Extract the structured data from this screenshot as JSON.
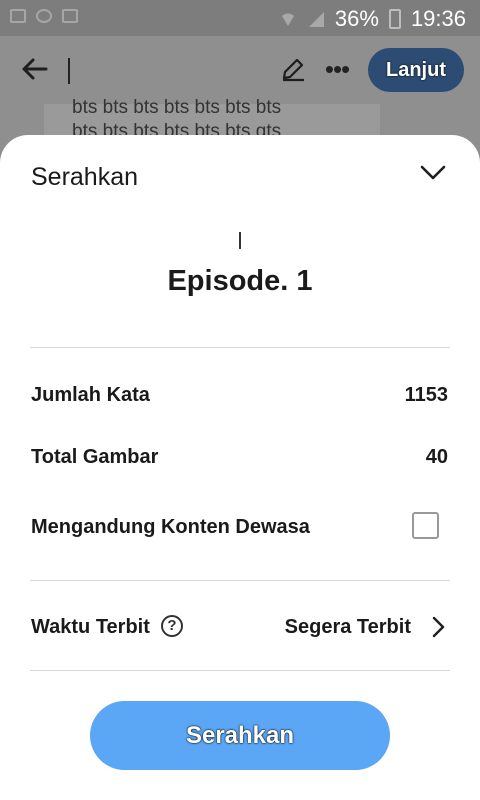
{
  "status_bar": {
    "battery": "36%",
    "time": "19:36"
  },
  "toolbar": {
    "title_value": "",
    "next_label": "Lanjut"
  },
  "background_editor": {
    "line1": "bts bts bts bts bts bts bts",
    "line2": "bts bts bts bts bts bts gts"
  },
  "sheet": {
    "title": "Serahkan",
    "episode_title": "Episode. 1",
    "rows": {
      "word_count_label": "Jumlah Kata",
      "word_count_value": "1153",
      "image_count_label": "Total Gambar",
      "image_count_value": "40",
      "adult_label": "Mengandung Konten Dewasa",
      "adult_checked": false,
      "publish_label": "Waktu Terbit",
      "publish_value": "Segera Terbit"
    },
    "submit_label": "Serahkan"
  },
  "colors": {
    "submit_button": "#5ba6f5",
    "next_button": "#2c4c73"
  }
}
